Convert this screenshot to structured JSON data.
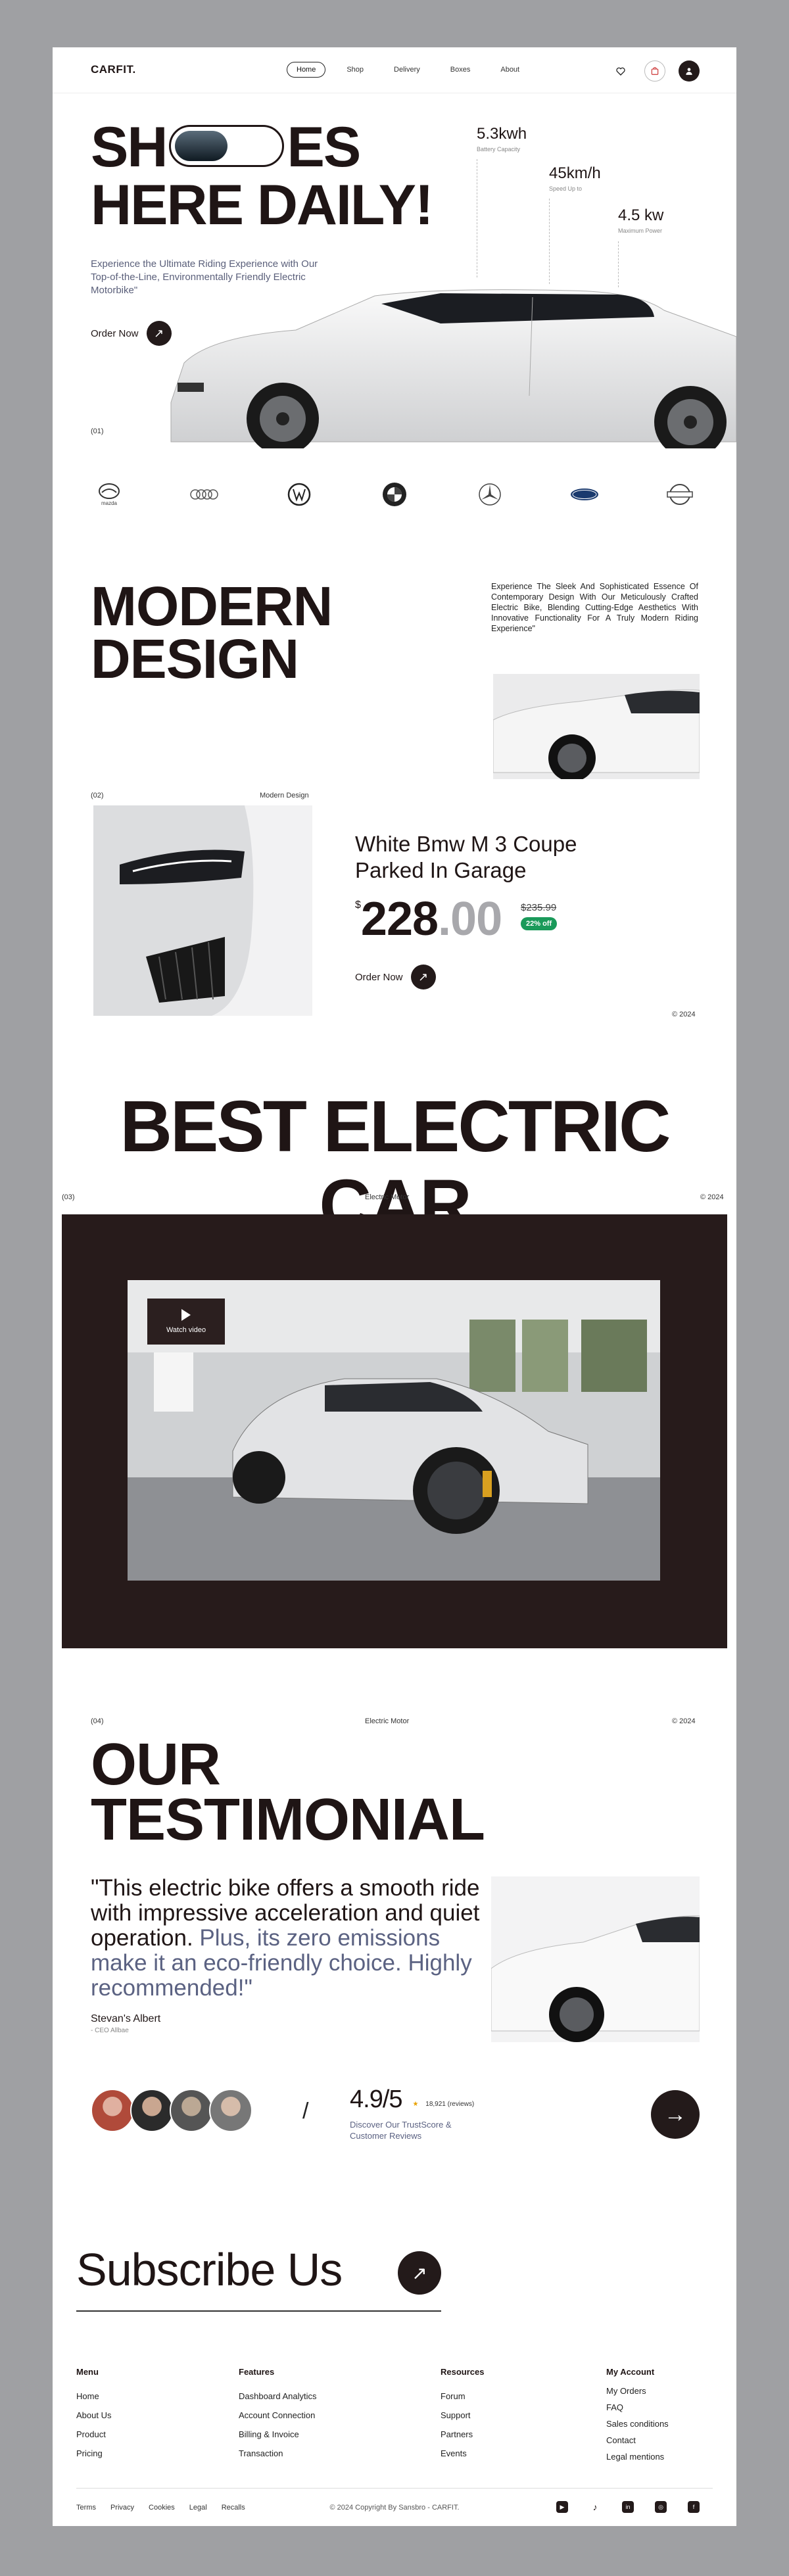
{
  "nav": {
    "logo": "CARFIT.",
    "items": [
      "Home",
      "Shop",
      "Delivery",
      "Boxes",
      "About"
    ],
    "active": "Home"
  },
  "hero": {
    "title_part1": "SH",
    "title_part2": "ES",
    "title_line2": "HERE DAILY!",
    "stats": [
      {
        "value": "5.3kwh",
        "label": "Battery Capacity"
      },
      {
        "value": "45km/h",
        "label": "Speed Up to"
      },
      {
        "value": "4.5 kw",
        "label": "Maximum Power"
      }
    ],
    "description": "Experience the Ultimate Riding Experience with Our Top-of-the-Line, Environmentally Friendly Electric Motorbike\"",
    "order_label": "Order Now",
    "section_num": "(01)"
  },
  "brands": [
    "mazda",
    "audi",
    "volkswagen",
    "bmw",
    "mercedes",
    "ford",
    "nissan"
  ],
  "design": {
    "title_line1": "MODERN",
    "title_line2": "DESIGN",
    "description": "Experience The Sleek And Sophisticated Essence Of Contemporary Design With Our Meticulously Crafted Electric Bike, Blending Cutting-Edge Aesthetics With Innovative Functionality For A Truly Modern Riding Experience\"",
    "section_num": "(02)",
    "section_label": "Modern Design",
    "product_title": "White Bmw M 3 Coupe Parked In Garage",
    "currency": "$",
    "price_int": "228",
    "price_dec": ".00",
    "old_price": "$235.99",
    "discount": "22% off",
    "order_label": "Order Now",
    "year": "© 2024"
  },
  "electric": {
    "title": "BEST ELECTRIC CAR",
    "section_num": "(03)",
    "section_label": "Electric Motor",
    "year": "© 2024",
    "watch_label": "Watch video"
  },
  "testimonial": {
    "section_num": "(04)",
    "section_label": "Electric Motor",
    "year": "© 2024",
    "title_line1": "OUR",
    "title_line2": "TESTIMONIAL",
    "quote_main": "\"This electric bike offers a smooth ride with impressive acceleration and quiet operation.",
    "quote_highlight": " Plus, its zero emissions make it an eco-friendly choice. Highly recommended!\"",
    "author": "Stevan's Albert",
    "author_role": "- CEO Allbae",
    "rating": "4.9/5",
    "reviews": "18,921 (reviews)",
    "trust_text": "Discover Our TrustScore & Customer Reviews"
  },
  "subscribe": {
    "title": "Subscribe Us"
  },
  "footer": {
    "columns": [
      {
        "title": "Menu",
        "links": [
          "Home",
          "About Us",
          "Product",
          "Pricing"
        ]
      },
      {
        "title": "Features",
        "links": [
          "Dashboard Analytics",
          "Account Connection",
          "Billing & Invoice",
          "Transaction"
        ]
      },
      {
        "title": "Resources",
        "links": [
          "Forum",
          "Support",
          "Partners",
          "Events"
        ]
      },
      {
        "title": "My Account",
        "links": [
          "My Orders",
          "FAQ",
          "Sales conditions",
          "Contact",
          "Legal mentions"
        ]
      }
    ],
    "legal": [
      "Terms",
      "Privacy",
      "Cookies",
      "Legal",
      "Recalls"
    ],
    "copyright": "© 2024 Copyright By Sansbro - CARFIT.",
    "social": [
      "youtube",
      "tiktok",
      "linkedin",
      "instagram",
      "facebook"
    ]
  },
  "colors": {
    "dark": "#231a1a",
    "accent_text": "#5b6282",
    "discount": "#1a9a5a",
    "background": "#9fa0a3"
  }
}
